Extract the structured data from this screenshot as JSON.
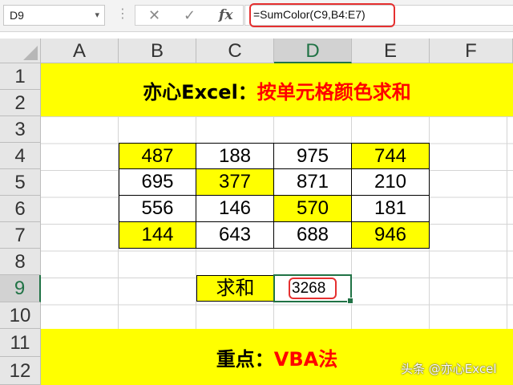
{
  "formula_bar": {
    "name_box": "D9",
    "name_box_arrow": "▾",
    "dots": "⋮",
    "cancel_glyph": "✕",
    "enter_glyph": "✓",
    "fx_label": "fx",
    "formula": "=SumColor(C9,B4:E7)"
  },
  "columns": [
    "A",
    "B",
    "C",
    "D",
    "E",
    "F"
  ],
  "rows": [
    "1",
    "2",
    "3",
    "4",
    "5",
    "6",
    "7",
    "8",
    "9",
    "10",
    "11",
    "12"
  ],
  "title": {
    "part1": "亦心Excel：",
    "part2": "按单元格颜色求和"
  },
  "table": {
    "r4": [
      "487",
      "188",
      "975",
      "744"
    ],
    "r5": [
      "695",
      "377",
      "871",
      "210"
    ],
    "r6": [
      "556",
      "146",
      "570",
      "181"
    ],
    "r7": [
      "144",
      "643",
      "688",
      "946"
    ]
  },
  "sum_label": "求和",
  "sum_value": "3268",
  "note": {
    "part1": "重点：",
    "part2": "VBA法"
  },
  "watermark": "头条 @亦心Excel",
  "colors": {
    "highlight": "#ffff00",
    "selection": "#217346",
    "annotation": "#e53030"
  }
}
